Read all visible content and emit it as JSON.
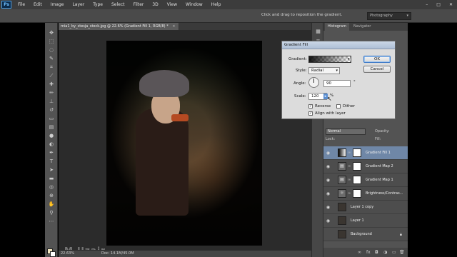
{
  "app": {
    "logo": "Ps"
  },
  "menu": {
    "items": [
      "File",
      "Edit",
      "Image",
      "Layer",
      "Type",
      "Select",
      "Filter",
      "3D",
      "View",
      "Window",
      "Help"
    ],
    "window_controls": [
      "–",
      "□",
      "✕"
    ]
  },
  "options": {
    "hint": "Click and drag to reposition the gradient.",
    "workspace": "Photography"
  },
  "document": {
    "tab_title": "mia1_by_stesja_stock.jpg @ 22.6% (Gradient Fill 1, RGB/8) *",
    "tab_close": "×"
  },
  "status": {
    "zoom": "22.63%",
    "doc_size": "Doc: 14.1M/45.0M"
  },
  "watermark": "M Uzair",
  "panel": {
    "tabs": [
      "Histogram",
      "Navigator"
    ]
  },
  "layers_panel": {
    "blend_mode": "Normal",
    "opacity_label": "Opacity:",
    "fill_label": "Fill:",
    "lock_label": "Lock:",
    "layers": [
      {
        "name": "Gradient Fill 1",
        "thumb": "gradient",
        "selected": true,
        "eye": true,
        "mask": true
      },
      {
        "name": "Gradient Map 2",
        "thumb": "adjustment",
        "selected": false,
        "eye": true,
        "mask": true
      },
      {
        "name": "Gradient Map 1",
        "thumb": "adjustment",
        "selected": false,
        "eye": true,
        "mask": true
      },
      {
        "name": "Brightness/Contras...",
        "thumb": "brightness",
        "selected": false,
        "eye": true,
        "mask": true
      },
      {
        "name": "Layer 1 copy",
        "thumb": "photo",
        "selected": false,
        "eye": true,
        "mask": false
      },
      {
        "name": "Layer 1",
        "thumb": "photo",
        "selected": false,
        "eye": true,
        "mask": false
      },
      {
        "name": "Background",
        "thumb": "photo",
        "selected": false,
        "eye": false,
        "mask": false,
        "locked": true
      }
    ]
  },
  "dialog": {
    "title": "Gradient Fill",
    "gradient_label": "Gradient:",
    "style_label": "Style:",
    "style_value": "Radial",
    "angle_label": "Angle:",
    "angle_value": "90",
    "angle_unit": "°",
    "scale_label": "Scale:",
    "scale_value": "120",
    "scale_unit": "%",
    "reverse_label": "Reverse",
    "reverse_checked": true,
    "dither_label": "Dither",
    "dither_checked": false,
    "align_label": "Align with layer",
    "align_checked": true,
    "ok_label": "OK",
    "cancel_label": "Cancel"
  }
}
